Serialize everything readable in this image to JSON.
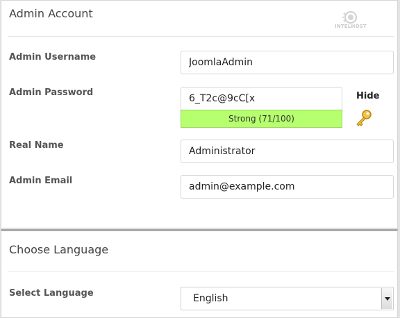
{
  "admin_section": {
    "title": "Admin Account",
    "logo_text": "INTELHOST",
    "username": {
      "label": "Admin Username",
      "value": "JoomlaAdmin"
    },
    "password": {
      "label": "Admin Password",
      "value": "6_T2c@9cC[x",
      "strength_text": "Strong (71/100)",
      "strength_score": 71,
      "strength_color": "#b6ff6e",
      "toggle_label": "Hide",
      "generate_icon": "key-icon"
    },
    "real_name": {
      "label": "Real Name",
      "value": "Administrator"
    },
    "email": {
      "label": "Admin Email",
      "value": "admin@example.com"
    }
  },
  "language_section": {
    "title": "Choose Language",
    "select": {
      "label": "Select Language",
      "selected": "English"
    }
  }
}
